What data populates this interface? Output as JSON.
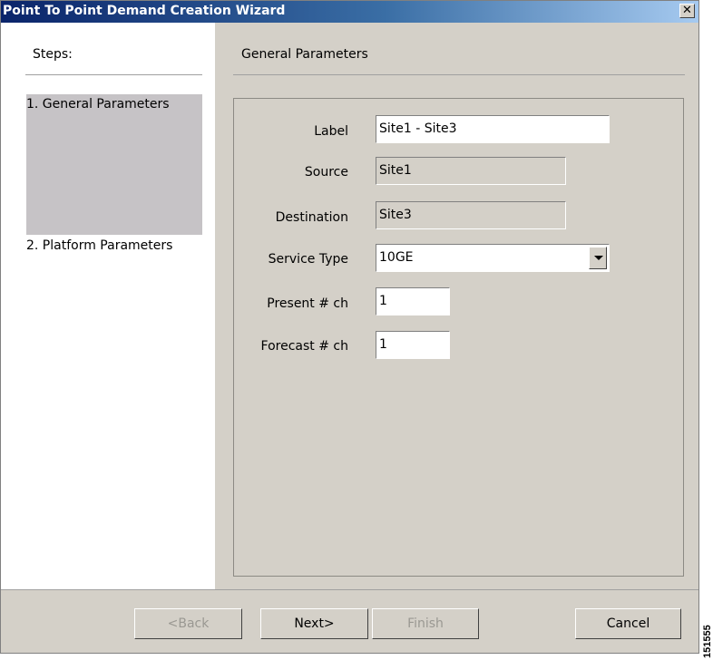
{
  "window": {
    "title": "Point To Point Demand Creation Wizard",
    "close_glyph": "✕",
    "icons": {
      "close": "close-icon"
    }
  },
  "steps": {
    "header": "Steps:",
    "items": [
      {
        "label": "1. General Parameters",
        "active": true
      },
      {
        "label": "2. Platform Parameters",
        "active": false
      }
    ]
  },
  "section": {
    "title": "General Parameters"
  },
  "form": {
    "label": {
      "label": "Label",
      "value": "Site1 - Site3"
    },
    "source": {
      "label": "Source",
      "value": "Site1"
    },
    "destination": {
      "label": "Destination",
      "value": "Site3"
    },
    "service_type": {
      "label": "Service Type",
      "value": "10GE"
    },
    "present_ch": {
      "label": "Present # ch",
      "value": "1"
    },
    "forecast_ch": {
      "label": "Forecast # ch",
      "value": "1"
    }
  },
  "buttons": {
    "back": {
      "label": "<Back",
      "enabled": false
    },
    "next": {
      "label": "Next>",
      "enabled": true
    },
    "finish": {
      "label": "Finish",
      "enabled": false
    },
    "cancel": {
      "label": "Cancel",
      "enabled": true
    }
  },
  "watermark": "151555",
  "colors": {
    "title_gradient_start": "#0a246a",
    "title_gradient_end": "#a6caf0",
    "dialog_bg": "#d4d0c8",
    "active_step_bg": "#c6c3c6"
  }
}
